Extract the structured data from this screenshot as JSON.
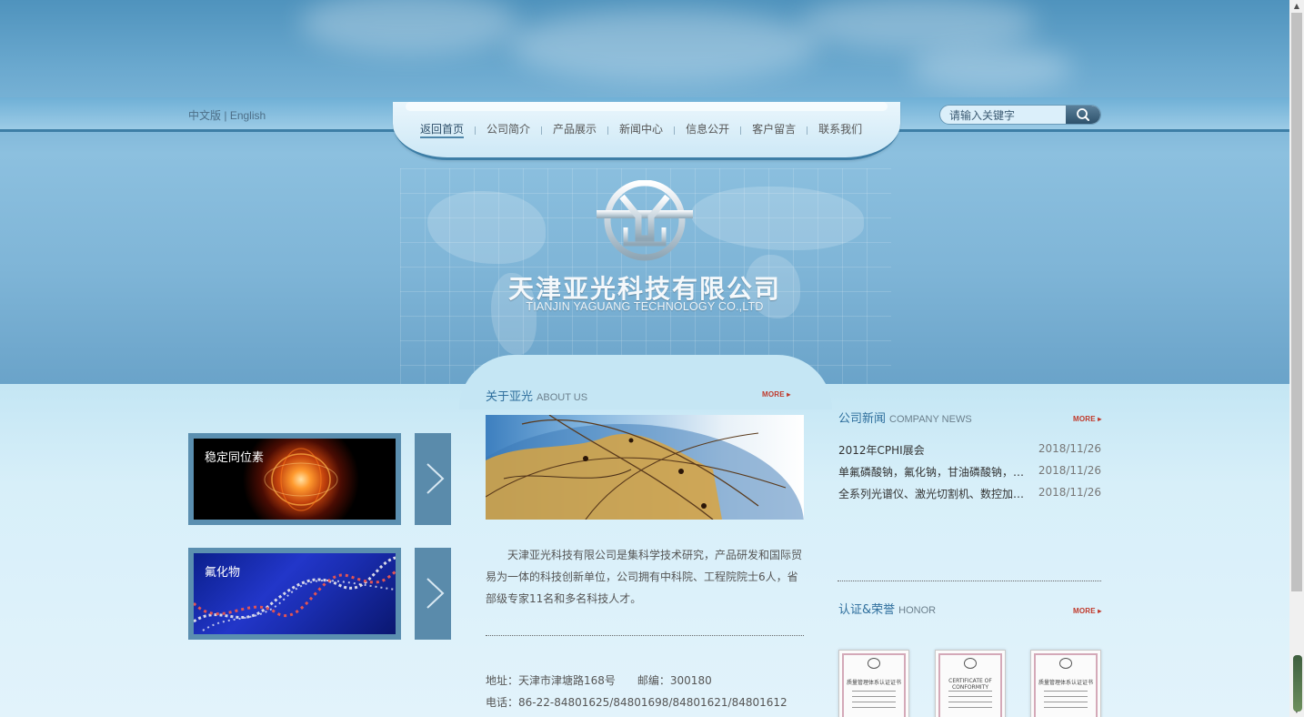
{
  "header": {
    "lang": {
      "cn": "中文版",
      "sep": "|",
      "en": "English"
    },
    "nav": [
      {
        "label": "返回首页",
        "active": true
      },
      {
        "label": "公司简介",
        "active": false
      },
      {
        "label": "产品展示",
        "active": false
      },
      {
        "label": "新闻中心",
        "active": false
      },
      {
        "label": "信息公开",
        "active": false
      },
      {
        "label": "客户留言",
        "active": false
      },
      {
        "label": "联系我们",
        "active": false
      }
    ],
    "search": {
      "placeholder": "请输入关键字",
      "icon": "search-icon"
    }
  },
  "brand": {
    "name_cn": "天津亚光科技有限公司",
    "name_en": "TIANJIN YAGUANG TECHNOLOGY CO.,LTD"
  },
  "products": [
    {
      "label": "稳定同位素"
    },
    {
      "label": "氟化物"
    }
  ],
  "about": {
    "title": "关于亚光",
    "subtitle": "ABOUT US",
    "more": "MORE",
    "text": "天津亚光科技有限公司是集科学技术研究，产品研发和国际贸易为一体的科技创新单位，公司拥有中科院、工程院院士6人，省部级专家11名和多名科技人才。",
    "address": "地址：天津市津塘路168号　　邮编：300180",
    "phone": "电话：86-22-84801625/84801698/84801621/84801612"
  },
  "news": {
    "title": "公司新闻",
    "subtitle": "COMPANY NEWS",
    "more": "MORE",
    "items": [
      {
        "title": "2012年CPHI展会",
        "date": "2018/11/26"
      },
      {
        "title": "单氟磷酸钠，氟化钠，甘油磷酸钠，六偏磷酸钠",
        "date": "2018/11/26"
      },
      {
        "title": "全系列光谱仪、激光切割机、数控加工中心",
        "date": "2018/11/26"
      }
    ]
  },
  "honor": {
    "title": "认证&荣誉",
    "subtitle": "HONOR",
    "more": "MORE",
    "certs": [
      {
        "title": "质量管理体系认证证书"
      },
      {
        "title": "CERTIFICATE OF CONFORMITY"
      },
      {
        "title": "质量管理体系认证证书"
      }
    ]
  },
  "colors": {
    "accent": "#2f6f9d",
    "more": "#c0392b",
    "nav_border": "#3d7ea6"
  }
}
